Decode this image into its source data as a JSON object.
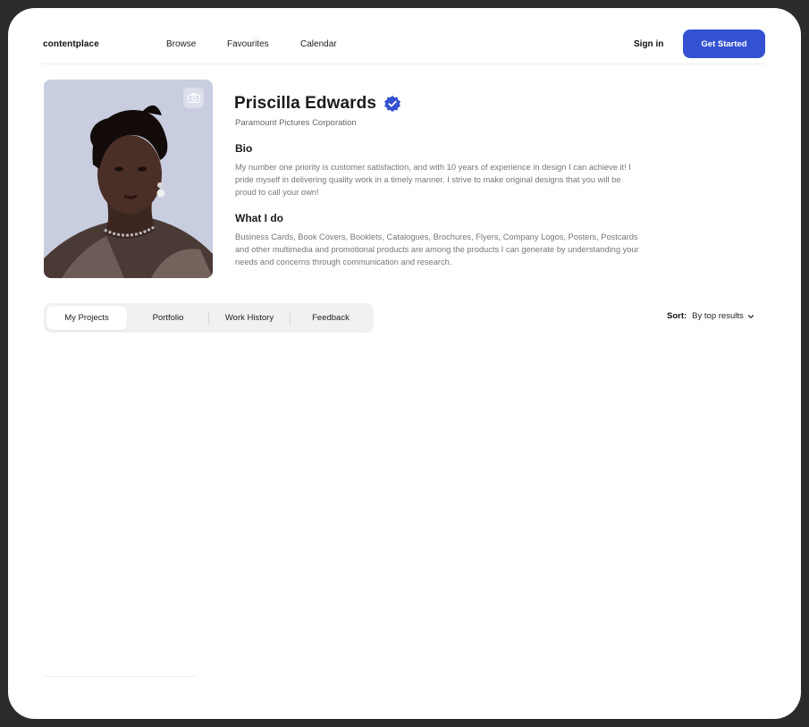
{
  "nav": {
    "logo": "contentplace",
    "links": [
      "Browse",
      "Favourites",
      "Calendar"
    ],
    "sign_in": "Sign in",
    "cta": "Get Started"
  },
  "profile": {
    "name": "Priscilla Edwards",
    "company": "Paramount Pictures Corporation",
    "bio_heading": "Bio",
    "bio": "My number one priority is customer satisfaction, and with 10 years of experience in design I can achieve it! I pride myself in delivering quality work in a timely manner. I strive to make original designs that you will be proud to call your own!",
    "what_heading": "What I do",
    "what": "Business Cards, Book Covers, Booklets, Catalogues, Brochures, Flyers, Company Logos, Posters, Postcards and other multimedia and promotional products are among the products I can generate by understanding your needs and concerns through communication and research."
  },
  "tabs": [
    {
      "label": "My Projects",
      "active": true
    },
    {
      "label": "Portfolio",
      "active": false
    },
    {
      "label": "Work History",
      "active": false
    },
    {
      "label": "Feedback",
      "active": false
    }
  ],
  "sort": {
    "label": "Sort:",
    "value": "By top results"
  },
  "icons": {
    "camera": "camera-icon",
    "verified": "verified-badge-icon",
    "chevron": "chevron-down-icon"
  },
  "colors": {
    "accent": "#3451d1",
    "photo_bg": "#c9cde0",
    "frame": "#2b2b2b"
  }
}
